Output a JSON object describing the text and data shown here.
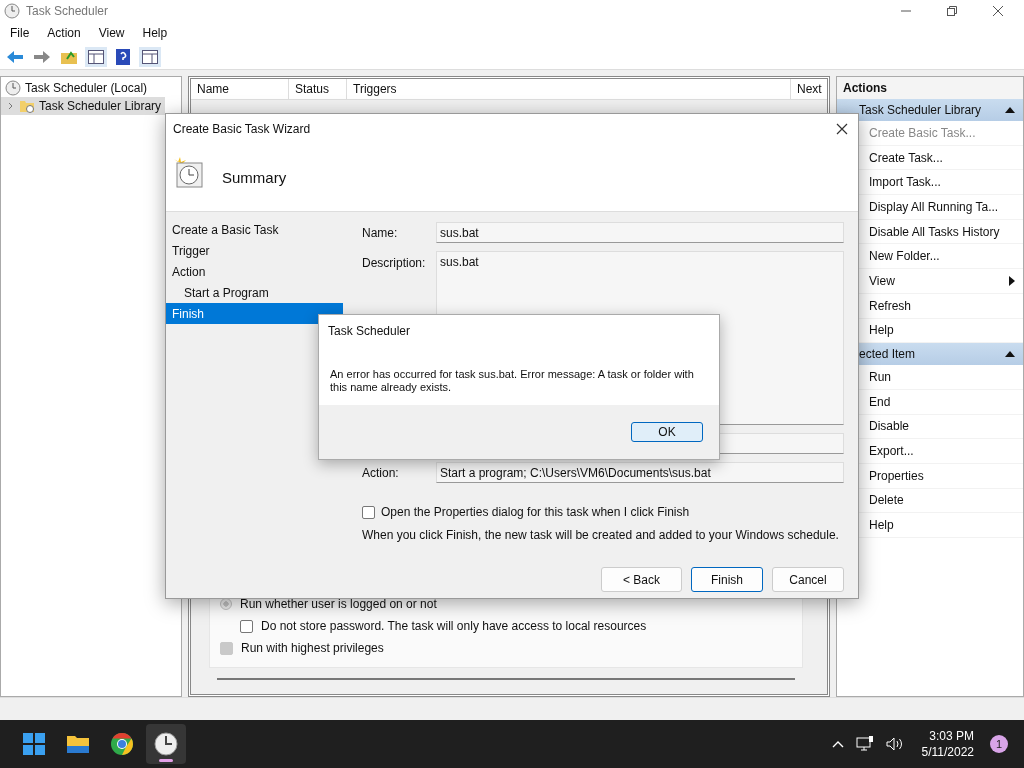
{
  "window": {
    "title": "Task Scheduler"
  },
  "menu": [
    "File",
    "Action",
    "View",
    "Help"
  ],
  "tree": [
    {
      "label": "Task Scheduler (Local)",
      "selected": false,
      "children": [
        {
          "label": "Task Scheduler Library",
          "selected": true,
          "expanded": false
        }
      ]
    }
  ],
  "table": {
    "columns": [
      "Name",
      "Status",
      "Triggers",
      "Next"
    ]
  },
  "general": {
    "options": [
      {
        "kind": "radio",
        "label": "Run whether user is logged on or not",
        "checked": true,
        "disabled": true,
        "children": [
          {
            "kind": "checkbox",
            "label": "Do not store password.  The task will only have access to local resources",
            "checked": false,
            "disabled": false
          }
        ]
      },
      {
        "kind": "checkbox",
        "label": "Run with highest privileges",
        "checked": true,
        "disabled": true
      }
    ]
  },
  "actions": {
    "title": "Actions",
    "sections": [
      {
        "title": "Task Scheduler Library",
        "expanded": true,
        "items": [
          {
            "label": "Create Basic Task...",
            "disabled": true,
            "submenu": false
          },
          {
            "label": "Create Task...",
            "disabled": false,
            "submenu": false
          },
          {
            "label": "Import Task...",
            "disabled": false,
            "submenu": false
          },
          {
            "label": "Display All Running Ta...",
            "disabled": false,
            "submenu": false
          },
          {
            "label": "Disable All Tasks History",
            "disabled": false,
            "submenu": false
          },
          {
            "label": "New Folder...",
            "disabled": false,
            "submenu": false
          },
          {
            "label": "View",
            "disabled": false,
            "submenu": true
          },
          {
            "label": "Refresh",
            "disabled": false,
            "submenu": false
          },
          {
            "label": "Help",
            "disabled": false,
            "submenu": false
          }
        ]
      },
      {
        "title": "ected Item",
        "expanded": true,
        "items": [
          {
            "label": "Run",
            "disabled": false,
            "submenu": false
          },
          {
            "label": "End",
            "disabled": false,
            "submenu": false
          },
          {
            "label": "Disable",
            "disabled": false,
            "submenu": false
          },
          {
            "label": "Export...",
            "disabled": false,
            "submenu": false
          },
          {
            "label": "Properties",
            "disabled": false,
            "submenu": false
          },
          {
            "label": "Delete",
            "disabled": false,
            "submenu": false
          },
          {
            "label": "Help",
            "disabled": false,
            "submenu": false
          }
        ]
      }
    ]
  },
  "wizard": {
    "title": "Create Basic Task Wizard",
    "heading": "Summary",
    "steps": [
      {
        "label": "Create a Basic Task",
        "selected": false
      },
      {
        "label": "Trigger",
        "selected": false
      },
      {
        "label": "Action",
        "selected": false,
        "children": [
          {
            "label": "Start a Program",
            "selected": false
          }
        ]
      },
      {
        "label": "Finish",
        "selected": true
      }
    ],
    "fields": [
      {
        "kind": "text",
        "label": "Name:",
        "value": "sus.bat"
      },
      {
        "kind": "textarea",
        "label": "Description:",
        "value": "sus.bat"
      },
      {
        "kind": "covered"
      },
      {
        "kind": "text",
        "label": "Action:",
        "value": "Start a program; C:\\Users\\VM6\\Documents\\sus.bat"
      }
    ],
    "open_properties": {
      "label": "Open the Properties dialog for this task when I click Finish",
      "checked": false
    },
    "note": "When you click Finish, the new task will be created and added to your Windows schedule.",
    "buttons": [
      {
        "label": "< Back",
        "default": false
      },
      {
        "label": "Finish",
        "default": true
      },
      {
        "label": "Cancel",
        "default": false
      }
    ]
  },
  "message_box": {
    "title": "Task Scheduler",
    "message": "An error has occurred for task sus.bat. Error message: A task or folder with this name already exists.",
    "button": {
      "label": "OK",
      "default": true
    }
  },
  "taskbar": {
    "apps": [
      {
        "kind": "start",
        "selected": false
      },
      {
        "kind": "explorer",
        "selected": false
      },
      {
        "kind": "chrome",
        "selected": false
      },
      {
        "kind": "scheduler",
        "selected": true
      }
    ],
    "time": "3:03 PM",
    "date": "5/11/2022",
    "notifications": "1"
  }
}
